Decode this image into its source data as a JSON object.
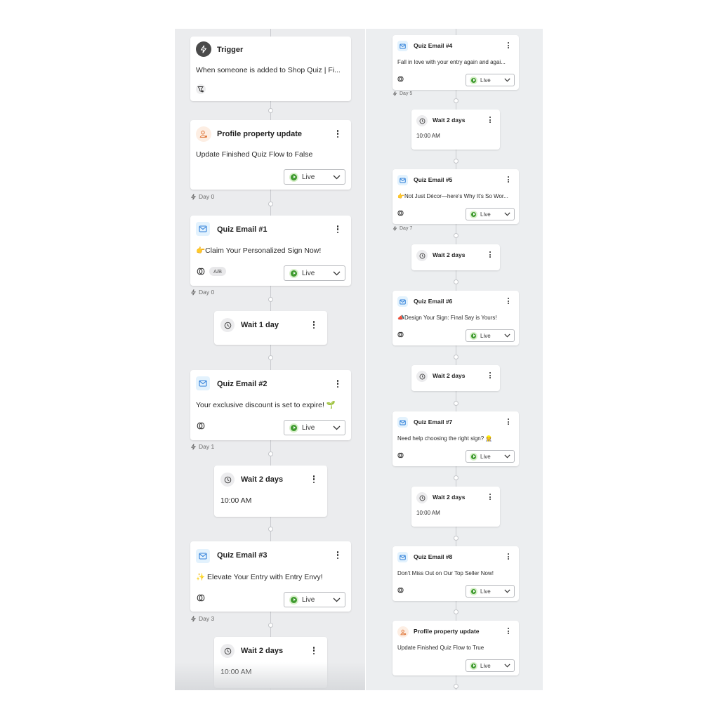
{
  "colors": {
    "canvas_bg": "#ebecee",
    "card_bg": "#ffffff",
    "live_green": "#3f9b2f",
    "email_icon_bg": "#e3f2fd",
    "email_icon": "#2f7fd9",
    "profile_icon_bg": "#fdeee3",
    "profile_icon": "#e07a3f",
    "trigger_icon_bg": "#4a4a4a"
  },
  "left_column": {
    "trigger": {
      "title": "Trigger",
      "body": "When someone is added to Shop Quiz | Fi...",
      "icon": "lightning-icon",
      "filter_icon": "filter-icon"
    },
    "profile_update_1": {
      "title": "Profile property update",
      "body": "Update Finished Quiz Flow to False",
      "status": "Live",
      "day": "Day 0"
    },
    "email_1": {
      "title": "Quiz Email #1",
      "body": "👉Claim Your Personalized Sign Now!",
      "badge": "A/B",
      "status": "Live",
      "day": "Day 0"
    },
    "wait_1": {
      "title": "Wait 1 day",
      "time": ""
    },
    "email_2": {
      "title": "Quiz Email #2",
      "body": "Your exclusive discount is set to expire! 🌱",
      "status": "Live",
      "day": "Day 1"
    },
    "wait_2": {
      "title": "Wait 2 days",
      "time": "10:00 AM"
    },
    "email_3": {
      "title": "Quiz Email #3",
      "body": "✨ Elevate Your Entry with Entry Envy!",
      "status": "Live",
      "day": "Day 3"
    },
    "wait_3": {
      "title": "Wait 2 days",
      "time": "10:00 AM"
    }
  },
  "right_column": {
    "email_4": {
      "title": "Quiz Email #4",
      "body": "Fall in love with your entry again and agai...",
      "status": "Live",
      "day": "Day 5"
    },
    "wait_4": {
      "title": "Wait 2 days",
      "time": "10:00 AM"
    },
    "email_5": {
      "title": "Quiz Email #5",
      "body": "👉Not Just Décor—here's Why It's So Wor...",
      "status": "Live",
      "day": "Day 7"
    },
    "wait_5": {
      "title": "Wait 2 days",
      "time": ""
    },
    "email_6": {
      "title": "Quiz Email #6",
      "body": "📣Design Your Sign: Final Say is Yours!",
      "status": "Live"
    },
    "wait_6": {
      "title": "Wait 2 days",
      "time": ""
    },
    "email_7": {
      "title": "Quiz Email #7",
      "body": "Need help choosing the right sign? 👷",
      "status": "Live"
    },
    "wait_7": {
      "title": "Wait 2 days",
      "time": "10:00 AM"
    },
    "email_8": {
      "title": "Quiz Email #8",
      "body": "Don't Miss Out on Our Top Seller Now!",
      "status": "Live"
    },
    "profile_update_2": {
      "title": "Profile property update",
      "body": "Update Finished Quiz Flow to True",
      "status": "Live"
    }
  }
}
